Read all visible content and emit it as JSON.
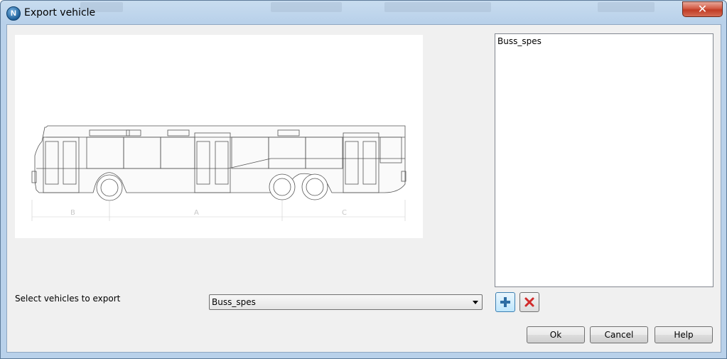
{
  "window": {
    "title": "Export vehicle",
    "app_icon_letter": "N",
    "close_glyph": "✕"
  },
  "vehicle_list": {
    "items": [
      "Buss_spes"
    ]
  },
  "selector": {
    "label": "Select vehicles to export",
    "selected": "Buss_spes"
  },
  "preview": {
    "dimension_labels": [
      "B",
      "A",
      "C"
    ]
  },
  "toolbar": {
    "add_icon": "plus-icon",
    "remove_icon": "red-x-icon"
  },
  "buttons": {
    "ok": "Ok",
    "cancel": "Cancel",
    "help": "Help"
  },
  "colors": {
    "add_icon": "#2e6da4",
    "remove_icon": "#d12a2a"
  }
}
